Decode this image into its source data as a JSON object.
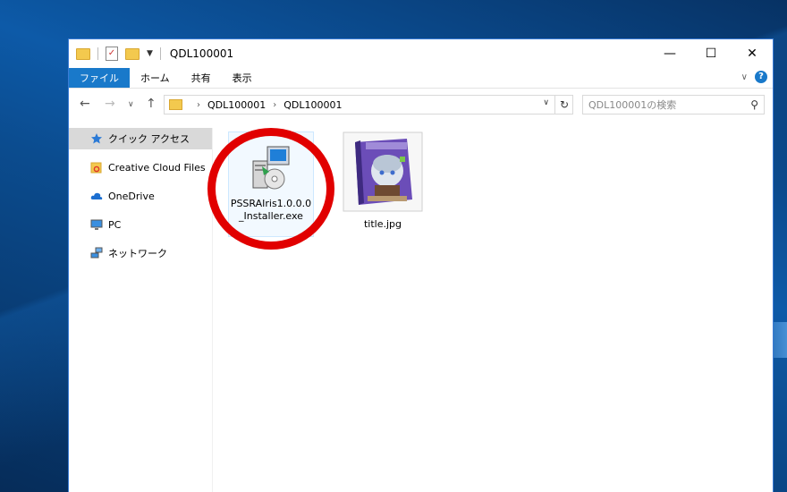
{
  "window": {
    "title": "QDL100001",
    "controls": {
      "minimize": "—",
      "maximize": "☐",
      "close": "✕"
    }
  },
  "ribbon": {
    "tabs": [
      "ファイル",
      "ホーム",
      "共有",
      "表示"
    ],
    "help": "?"
  },
  "address": {
    "crumbs": [
      "QDL100001",
      "QDL100001"
    ],
    "search_placeholder": "QDL100001の検索"
  },
  "navpane": {
    "items": [
      {
        "label": "クイック アクセス",
        "icon": "star-icon",
        "selected": true
      },
      {
        "label": "Creative Cloud Files",
        "icon": "creative-cloud-folder-icon",
        "selected": false
      },
      {
        "label": "OneDrive",
        "icon": "cloud-icon",
        "selected": false
      },
      {
        "label": "PC",
        "icon": "monitor-icon",
        "selected": false
      },
      {
        "label": "ネットワーク",
        "icon": "network-icon",
        "selected": false
      }
    ]
  },
  "files": [
    {
      "name": "PSSRAIris1.0.0.0_Installer.exe",
      "icon": "installer-icon"
    },
    {
      "name": "title.jpg",
      "icon": "image-thumbnail-icon"
    }
  ],
  "colors": {
    "accent": "#1979ca",
    "annotation": "#e10000"
  }
}
